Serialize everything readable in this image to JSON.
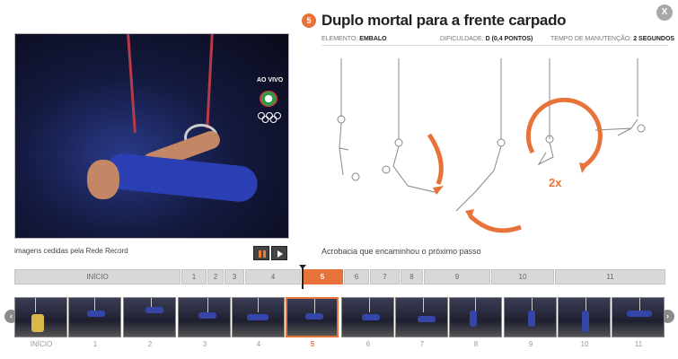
{
  "video": {
    "live_label": "AO VIVO",
    "caption": "imagens cedidas pela Rede Record"
  },
  "controls": {
    "pause_icon": "pause-icon",
    "play_icon": "play-icon"
  },
  "header": {
    "step_number": "5",
    "title": "Duplo mortal para a frente carpado",
    "close_label": "X"
  },
  "info": {
    "element_key": "ELEMENTO:",
    "element_value": "EMBALO",
    "difficulty_key": "DIFICULDADE:",
    "difficulty_value": "D (0,4 PONTOS)",
    "hold_key": "TEMPO DE MANUTENÇÃO:",
    "hold_value": "2 SEGUNDOS"
  },
  "illustration": {
    "multiplier_label": "2x",
    "caption": "Acrobacia que encaminhou o próximo passo"
  },
  "timeline": {
    "segments": [
      {
        "label": "INÍCIO"
      },
      {
        "label": "1"
      },
      {
        "label": "2"
      },
      {
        "label": "3"
      },
      {
        "label": "4"
      },
      {
        "label": "5"
      },
      {
        "label": "6"
      },
      {
        "label": "7"
      },
      {
        "label": "8"
      },
      {
        "label": "9"
      },
      {
        "label": "10"
      },
      {
        "label": "11"
      }
    ],
    "active_index": 5
  },
  "thumbnails": {
    "labels": [
      "INÍCIO",
      "1",
      "2",
      "3",
      "4",
      "5",
      "6",
      "7",
      "8",
      "9",
      "10",
      "11"
    ],
    "active_index": 5
  },
  "nav": {
    "prev": "‹",
    "next": "›"
  },
  "colors": {
    "accent": "#e8733a",
    "segment": "#d8d8d8"
  }
}
